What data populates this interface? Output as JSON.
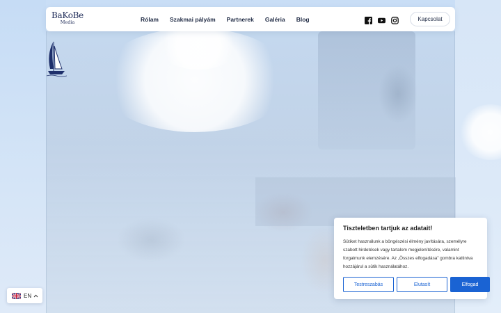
{
  "logo": {
    "main": "BaKoBe",
    "sub": "Media"
  },
  "nav": {
    "items": [
      {
        "label": "Rólam"
      },
      {
        "label": "Szakmai pályám"
      },
      {
        "label": "Partnerek"
      },
      {
        "label": "Galéria"
      },
      {
        "label": "Blog"
      }
    ]
  },
  "social": {
    "icons": [
      "facebook-icon",
      "youtube-icon",
      "instagram-icon"
    ]
  },
  "header": {
    "contact_label": "Kapcsolat"
  },
  "cookie": {
    "title": "Tiszteletben tartjuk az adatait!",
    "text": "Sütiket használunk a böngészési élmény javítására, személyre szabott hirdetések vagy tartalom megjelenítésére, valamint forgalmunk elemzésére. Az „Összes elfogadása” gombra kattintva hozzájárul a sütik használatához.",
    "customize_label": "Testreszabás",
    "reject_label": "Elutasít",
    "accept_label": "Elfogad",
    "accent": "#1a63d3"
  },
  "language": {
    "code": "EN",
    "flag": "uk-flag-icon"
  }
}
